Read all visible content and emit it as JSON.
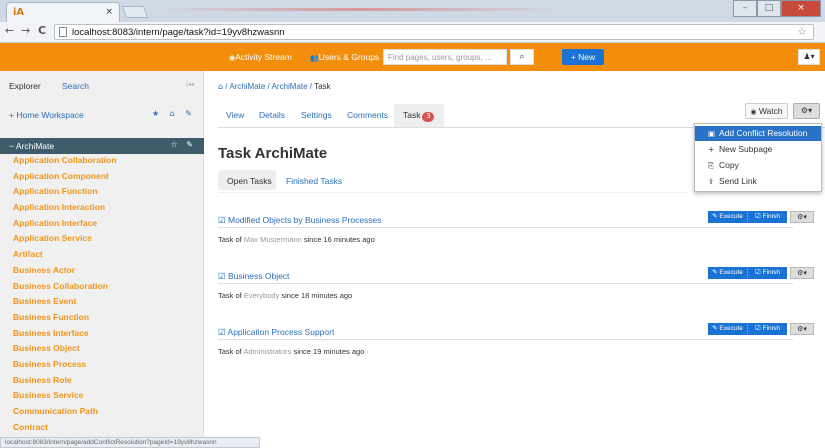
{
  "browser": {
    "tab_icon": "iA",
    "tab_title": "iA",
    "tab_close": "×",
    "url_host": "localhost",
    "url_rest": ":8083/intern/page/task?id=19yv8hzwasnn",
    "nav_back": "←",
    "nav_forward": "→",
    "nav_reload": "C",
    "star": "☆",
    "status_url": "localhost:8083/intern/page/addConflictResolution?pageId=19yv8hzwasnn"
  },
  "header": {
    "activity_stream": "Activity Stream",
    "users_groups": "Users & Groups",
    "search_placeholder": "Find pages, users, groups, ...",
    "search_icon": "🔍",
    "new_label": "+ New",
    "user_menu": "👤▾"
  },
  "sidebar": {
    "tab_explorer": "Explorer",
    "tab_search": "Search",
    "collapse": "|◂◂",
    "home": "+ Home Workspace",
    "home_icons": "★ ⌂ ✎",
    "section": "− ArchiMate",
    "section_icons": "☆ ✎",
    "items": [
      "Application Collaboration",
      "Application Component",
      "Application Function",
      "Application Interaction",
      "Application Interface",
      "Application Service",
      "Artifact",
      "Business Actor",
      "Business Collaboration",
      "Business Event",
      "Business Function",
      "Business Interface",
      "Business Object",
      "Business Process",
      "Business Role",
      "Business Service",
      "Communication Path",
      "Contract"
    ]
  },
  "main": {
    "breadcrumb": [
      "ArchiMate",
      "ArchiMate",
      "Task"
    ],
    "tabs": [
      "View",
      "Details",
      "Settings",
      "Comments",
      "Task"
    ],
    "task_badge": "3",
    "watch": "Watch",
    "title": "Task ArchiMate",
    "task_tabs": [
      "Open Tasks",
      "Finished Tasks"
    ],
    "tasks": [
      {
        "title": "Modified Objects by Business Processes",
        "prefix": "Task of",
        "who": "Max Mustermann",
        "when": "since 16 minutes ago"
      },
      {
        "title": "Business Object",
        "prefix": "Task of",
        "who": "Everybody",
        "when": "since 18 minutes ago"
      },
      {
        "title": "Application Process Support",
        "prefix": "Task of",
        "who": "Administrators",
        "when": "since 19 minutes ago"
      }
    ],
    "execute": "Execute",
    "finish": "Finish"
  },
  "dropdown": {
    "items": [
      "Add Conflict Resolution",
      "New Subpage",
      "Copy",
      "Send Link"
    ]
  },
  "colors": {
    "accent_orange": "#f28e0c",
    "primary_blue": "#1a73d4",
    "section_dark": "#3f5c6c",
    "link_blue": "#2a6fb8",
    "sidebar_item_orange": "#f0951a"
  }
}
